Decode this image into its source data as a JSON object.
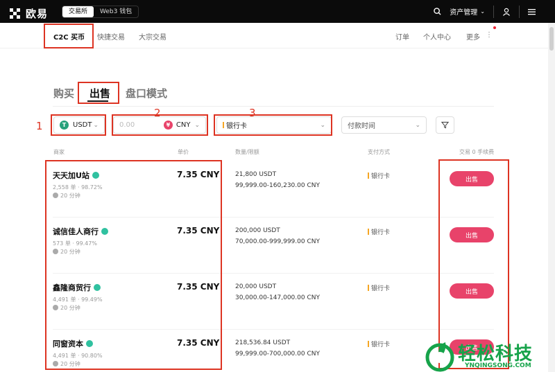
{
  "topbar": {
    "logo_text": "欧易",
    "mode_tabs": [
      "交易所",
      "Web3 钱包"
    ],
    "asset_label": "资产管理"
  },
  "subnav": {
    "left": [
      "C2C 买币",
      "快捷交易",
      "大宗交易"
    ],
    "right": [
      "订单",
      "个人中心",
      "更多"
    ]
  },
  "tabs": {
    "buy": "购买",
    "sell": "出售",
    "book": "盘口模式"
  },
  "filters": {
    "coin": "USDT",
    "amount_placeholder": "0.00",
    "currency": "CNY",
    "payment": "银行卡",
    "pay_time": "付款时间",
    "numbers": [
      "1",
      "2",
      "3"
    ]
  },
  "table": {
    "headers": {
      "merchant": "商家",
      "price": "单价",
      "qty": "数量/限额",
      "pay": "支付方式",
      "fee": "交易 0 手续费"
    },
    "rows": [
      {
        "name": "天天加U站",
        "stats": "2,558 单 · 98.72%",
        "time": "20 分钟",
        "price": "7.35 CNY",
        "qty": "21,800 USDT",
        "limit": "99,999.00-160,230.00 CNY",
        "pay": "银行卡",
        "action": "出售"
      },
      {
        "name": "诚信佳人商行",
        "stats": "573 单 · 99.47%",
        "time": "20 分钟",
        "price": "7.35 CNY",
        "qty": "200,000 USDT",
        "limit": "70,000.00-999,999.00 CNY",
        "pay": "银行卡",
        "action": "出售"
      },
      {
        "name": "鑫隆商贸行",
        "stats": "4,491 单 · 99.49%",
        "time": "20 分钟",
        "price": "7.35 CNY",
        "qty": "20,000 USDT",
        "limit": "30,000.00-147,000.00 CNY",
        "pay": "银行卡",
        "action": "出售"
      },
      {
        "name": "同窗资本",
        "stats": "4,491 单 · 90.80%",
        "time": "20 分钟",
        "price": "7.35 CNY",
        "qty": "218,536.84 USDT",
        "limit": "99,999.00-700,000.00 CNY",
        "pay": "银行卡",
        "action": "出售"
      }
    ]
  },
  "watermark": {
    "text": "轻松科技",
    "url": "YNQINGSONG.COM"
  },
  "colors": {
    "accent": "#e8436a",
    "annotation": "#d33322",
    "tether": "#26a17b",
    "cny": "#e8436a",
    "watermark": "#16a34a"
  }
}
